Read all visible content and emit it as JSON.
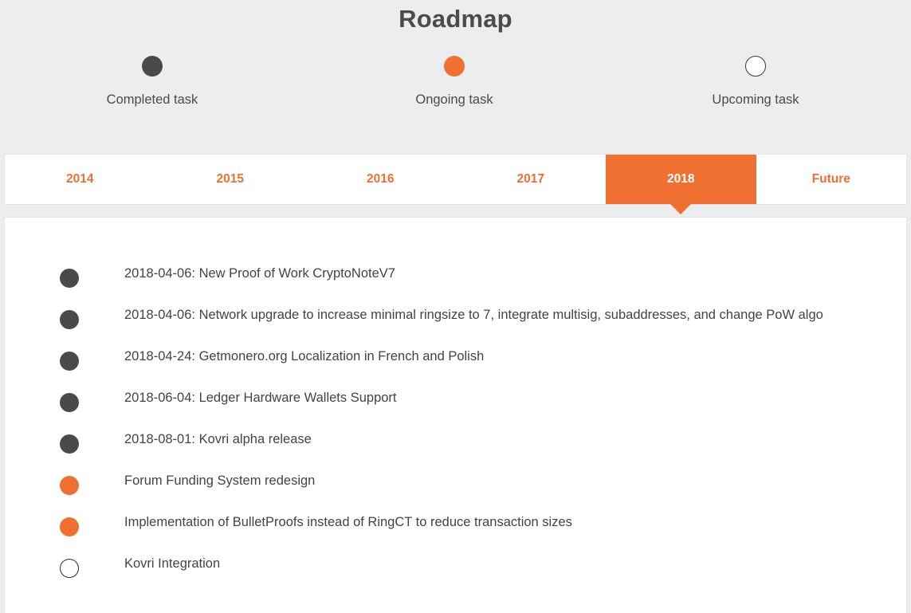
{
  "header": {
    "title": "Roadmap",
    "legend": [
      {
        "label": "Completed task",
        "status": "completed",
        "icon": "filled-dark-circle-icon"
      },
      {
        "label": "Ongoing task",
        "status": "ongoing",
        "icon": "filled-orange-circle-icon"
      },
      {
        "label": "Upcoming task",
        "status": "upcoming",
        "icon": "outline-circle-icon"
      }
    ]
  },
  "tabs": [
    {
      "label": "2014",
      "active": false
    },
    {
      "label": "2015",
      "active": false
    },
    {
      "label": "2016",
      "active": false
    },
    {
      "label": "2017",
      "active": false
    },
    {
      "label": "2018",
      "active": true
    },
    {
      "label": "Future",
      "active": false
    }
  ],
  "tasks": [
    {
      "status": "completed",
      "text": "2018-04-06: New Proof of Work CryptoNoteV7"
    },
    {
      "status": "completed",
      "text": "2018-04-06: Network upgrade to increase minimal ringsize to 7, integrate multisig, subaddresses, and change PoW algo"
    },
    {
      "status": "completed",
      "text": "2018-04-24: Getmonero.org Localization in French and Polish"
    },
    {
      "status": "completed",
      "text": "2018-06-04: Ledger Hardware Wallets Support"
    },
    {
      "status": "completed",
      "text": "2018-08-01: Kovri alpha release"
    },
    {
      "status": "ongoing",
      "text": "Forum Funding System redesign"
    },
    {
      "status": "ongoing",
      "text": "Implementation of BulletProofs instead of RingCT to reduce transaction sizes"
    },
    {
      "status": "upcoming",
      "text": "Kovri Integration"
    }
  ],
  "colors": {
    "accent_orange": "#ef7031",
    "completed_dark": "#4a4a4a",
    "page_background": "#ebedee",
    "panel_background": "#ffffff",
    "text_dark": "#3f4448"
  }
}
